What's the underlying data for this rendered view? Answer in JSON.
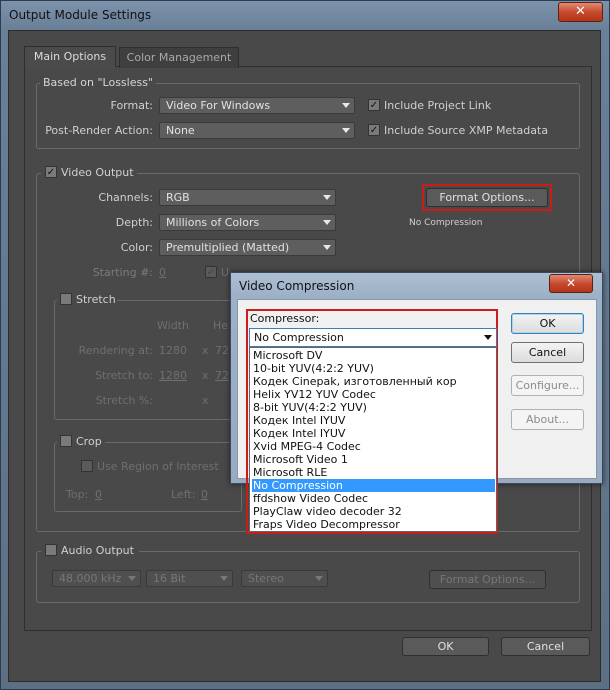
{
  "window": {
    "title": "Output Module Settings",
    "close_glyph": "✕"
  },
  "tabs": [
    {
      "label": "Main Options",
      "active": true
    },
    {
      "label": "Color Management",
      "active": false
    }
  ],
  "based_on": {
    "label": "Based on \"Lossless\"",
    "format_label": "Format:",
    "format_value": "Video For Windows",
    "post_render_label": "Post-Render Action:",
    "post_render_value": "None",
    "include_project_link": "Include Project Link",
    "include_xmp": "Include Source XMP Metadata"
  },
  "video_output": {
    "label": "Video Output",
    "channels_label": "Channels:",
    "channels_value": "RGB",
    "depth_label": "Depth:",
    "depth_value": "Millions of Colors",
    "color_label": "Color:",
    "color_value": "Premultiplied (Matted)",
    "starting_label": "Starting #:",
    "starting_value": "0",
    "format_options_button": "Format Options...",
    "compression_status": "No Compression",
    "partial_label": "U"
  },
  "stretch": {
    "label": "Stretch",
    "width_header": "Width",
    "height_header": "He",
    "rendering_at_label": "Rendering at:",
    "rendering_at_w": "1280",
    "rendering_at_h": "72",
    "stretch_to_label": "Stretch to:",
    "stretch_to_w": "1280",
    "stretch_to_h": "72",
    "stretch_pct_label": "Stretch %:",
    "x_sep": "x"
  },
  "crop": {
    "label": "Crop",
    "use_roi": "Use Region of Interest",
    "top_label": "Top:",
    "top_value": "0",
    "left_label": "Left:",
    "left_value": "0"
  },
  "audio_output": {
    "label": "Audio Output",
    "rate_value": "48.000 kHz",
    "bits_value": "16 Bit",
    "channels_value": "Stereo",
    "format_options_button": "Format Options..."
  },
  "buttons": {
    "ok": "OK",
    "cancel": "Cancel"
  },
  "video_compression": {
    "title": "Video Compression",
    "close_glyph": "✕",
    "compressor_label": "Compressor:",
    "selected": "No Compression",
    "options": [
      "Microsoft DV",
      "10-bit YUV(4:2:2 YUV)",
      "Кодек Cinepak, изготовленный кор",
      "Helix YV12 YUV Codec",
      "8-bit YUV(4:2:2 YUV)",
      "Кодек Intel IYUV",
      "Кодек Intel IYUV",
      "Xvid MPEG-4 Codec",
      "Microsoft Video 1",
      "Microsoft RLE",
      "No Compression",
      "ffdshow Video Codec",
      "PlayClaw video decoder 32",
      "Fraps Video Decompressor"
    ],
    "highlighted_index": 10,
    "ok": "OK",
    "cancel": "Cancel",
    "configure": "Configure...",
    "about": "About..."
  }
}
